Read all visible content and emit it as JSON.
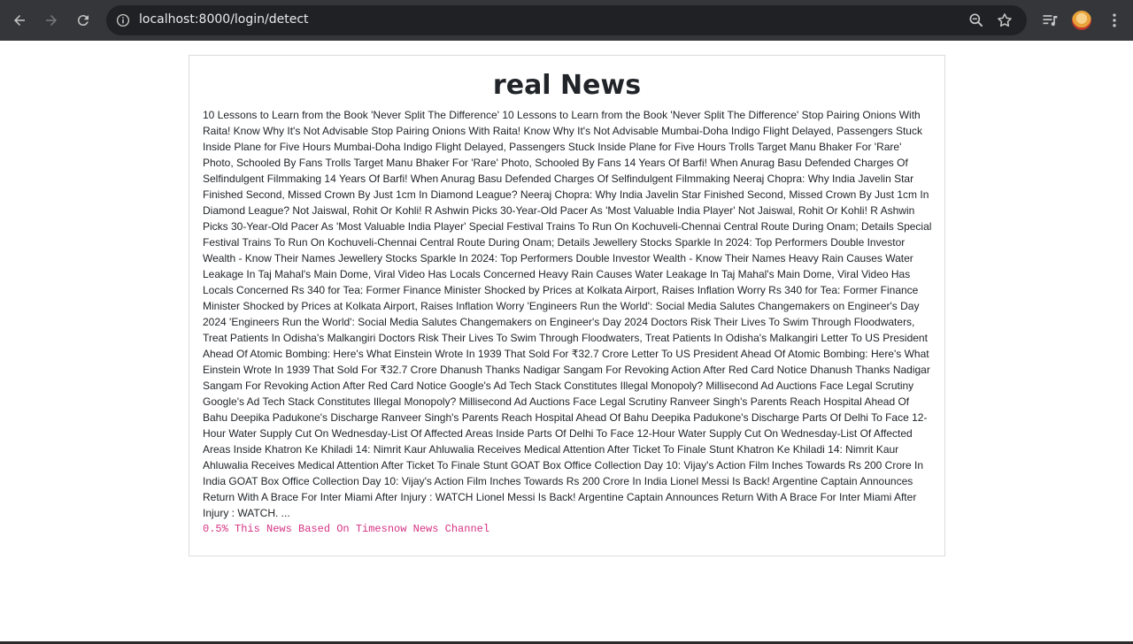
{
  "browser": {
    "url": "localhost:8000/login/detect",
    "icons": {
      "back": "arrow-left-icon",
      "forward": "arrow-right-icon",
      "reload": "reload-icon",
      "site_info": "info-icon",
      "zoom": "zoom-icon",
      "bookmark": "star-icon",
      "media": "media-controls-icon",
      "profile": "avatar",
      "menu": "kebab-menu-icon"
    }
  },
  "page": {
    "title": "real News",
    "article_text": "10 Lessons to Learn from the Book 'Never Split The Difference' 10 Lessons to Learn from the Book 'Never Split The Difference' Stop Pairing Onions With Raita! Know Why It's Not Advisable Stop Pairing Onions With Raita! Know Why It's Not Advisable Mumbai-Doha Indigo Flight Delayed, Passengers Stuck Inside Plane for Five Hours Mumbai-Doha Indigo Flight Delayed, Passengers Stuck Inside Plane for Five Hours Trolls Target Manu Bhaker For 'Rare' Photo, Schooled By Fans Trolls Target Manu Bhaker For 'Rare' Photo, Schooled By Fans 14 Years Of Barfi! When Anurag Basu Defended Charges Of Selfindulgent Filmmaking 14 Years Of Barfi! When Anurag Basu Defended Charges Of Selfindulgent Filmmaking Neeraj Chopra: Why India Javelin Star Finished Second, Missed Crown By Just 1cm In Diamond League? Neeraj Chopra: Why India Javelin Star Finished Second, Missed Crown By Just 1cm In Diamond League? Not Jaiswal, Rohit Or Kohli! R Ashwin Picks 30-Year-Old Pacer As 'Most Valuable India Player' Not Jaiswal, Rohit Or Kohli! R Ashwin Picks 30-Year-Old Pacer As 'Most Valuable India Player' Special Festival Trains To Run On Kochuveli-Chennai Central Route During Onam; Details Special Festival Trains To Run On Kochuveli-Chennai Central Route During Onam; Details Jewellery Stocks Sparkle In 2024: Top Performers Double Investor Wealth - Know Their Names Jewellery Stocks Sparkle In 2024: Top Performers Double Investor Wealth - Know Their Names Heavy Rain Causes Water Leakage In Taj Mahal's Main Dome, Viral Video Has Locals Concerned Heavy Rain Causes Water Leakage In Taj Mahal's Main Dome, Viral Video Has Locals Concerned Rs 340 for Tea: Former Finance Minister Shocked by Prices at Kolkata Airport, Raises Inflation Worry Rs 340 for Tea: Former Finance Minister Shocked by Prices at Kolkata Airport, Raises Inflation Worry 'Engineers Run the World': Social Media Salutes Changemakers on Engineer's Day 2024 'Engineers Run the World': Social Media Salutes Changemakers on Engineer's Day 2024 Doctors Risk Their Lives To Swim Through Floodwaters, Treat Patients In Odisha's Malkangiri Doctors Risk Their Lives To Swim Through Floodwaters, Treat Patients In Odisha's Malkangiri Letter To US President Ahead Of Atomic Bombing: Here's What Einstein Wrote In 1939 That Sold For ₹32.7 Crore Letter To US President Ahead Of Atomic Bombing: Here's What Einstein Wrote In 1939 That Sold For ₹32.7 Crore Dhanush Thanks Nadigar Sangam For Revoking Action After Red Card Notice Dhanush Thanks Nadigar Sangam For Revoking Action After Red Card Notice Google's Ad Tech Stack Constitutes Illegal Monopoly? Millisecond Ad Auctions Face Legal Scrutiny Google's Ad Tech Stack Constitutes Illegal Monopoly? Millisecond Ad Auctions Face Legal Scrutiny Ranveer Singh's Parents Reach Hospital Ahead Of Bahu Deepika Padukone's Discharge Ranveer Singh's Parents Reach Hospital Ahead Of Bahu Deepika Padukone's Discharge Parts Of Delhi To Face 12-Hour Water Supply Cut On Wednesday-List Of Affected Areas Inside Parts Of Delhi To Face 12-Hour Water Supply Cut On Wednesday-List Of Affected Areas Inside Khatron Ke Khiladi 14: Nimrit Kaur Ahluwalia Receives Medical Attention After Ticket To Finale Stunt Khatron Ke Khiladi 14: Nimrit Kaur Ahluwalia Receives Medical Attention After Ticket To Finale Stunt GOAT Box Office Collection Day 10: Vijay's Action Film Inches Towards Rs 200 Crore In India GOAT Box Office Collection Day 10: Vijay's Action Film Inches Towards Rs 200 Crore In India Lionel Messi Is Back! Argentine Captain Announces Return With A Brace For Inter Miami After Injury : WATCH Lionel Messi Is Back! Argentine Captain Announces Return With A Brace For Inter Miami After Injury : WATCH. ...",
    "result_text": "0.5% This News Based On Timesnow News Channel"
  },
  "colors": {
    "toolbar": "#35363a",
    "omnibox": "#202124",
    "result_text": "#d63384"
  }
}
